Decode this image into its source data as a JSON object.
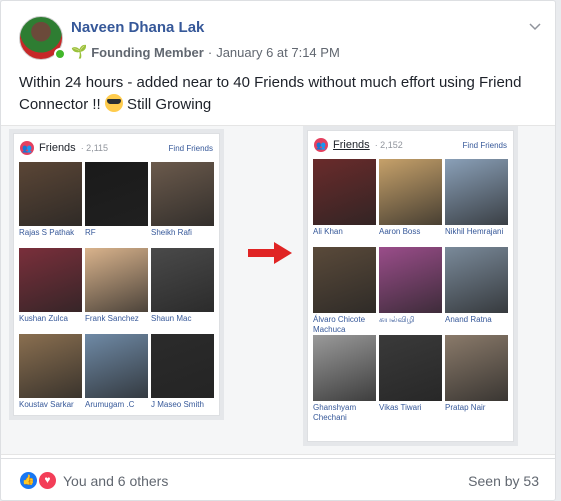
{
  "post": {
    "author": "Naveen Dhana Lak",
    "badge": "Founding Member",
    "timestamp": "January 6 at 7:14 PM",
    "text": "Within 24 hours - added near to 40 Friends without much effort using Friend Connector !! ",
    "text_tail": " Still Growing",
    "options_icon": "chevron-down-icon"
  },
  "left_card": {
    "title": "Friends",
    "count": "· 2,115",
    "find": "Find Friends",
    "friends": [
      {
        "name": "Rajas S Pathak",
        "color": "#5b4636"
      },
      {
        "name": "RF",
        "color": "#1a1a1a"
      },
      {
        "name": "Sheikh Rafi",
        "color": "#6b5a4c"
      },
      {
        "name": "Kushan Zulca",
        "color": "#7a2f3b"
      },
      {
        "name": "Frank Sanchez",
        "color": "#d9b38c"
      },
      {
        "name": "Shaun Mac",
        "color": "#4a4a4a"
      },
      {
        "name": "Koustav Sarkar",
        "color": "#8a6f50"
      },
      {
        "name": "Arumugam .C",
        "color": "#6f8aa6"
      },
      {
        "name": "J Maseo Smith",
        "color": "#2b2b2b"
      }
    ]
  },
  "right_card": {
    "title": "Friends",
    "count": "· 2,152",
    "find": "Find Friends",
    "friends": [
      {
        "name": "Ali Khan",
        "color": "#6a2b2b"
      },
      {
        "name": "Aaron Boss",
        "color": "#c6a16a"
      },
      {
        "name": "Nikhil Hemrajani",
        "color": "#8aa0b8"
      },
      {
        "name": "Álvaro Chicote Machuca",
        "color": "#5a4a3a"
      },
      {
        "name": "கயல்விழி",
        "color": "#9a4d8a"
      },
      {
        "name": "Anand Ratna",
        "color": "#7a8a9a"
      },
      {
        "name": "Ghanshyam Chechani",
        "color": "#9a9a9a"
      },
      {
        "name": "Vikas Tiwari",
        "color": "#3a3a3a"
      },
      {
        "name": "Pratap Nair",
        "color": "#8a7a6a"
      }
    ]
  },
  "footer": {
    "reactions_text": "You and 6 others",
    "seen": "Seen by 53"
  },
  "colors": {
    "link": "#365899",
    "accent_red": "#e02424"
  }
}
